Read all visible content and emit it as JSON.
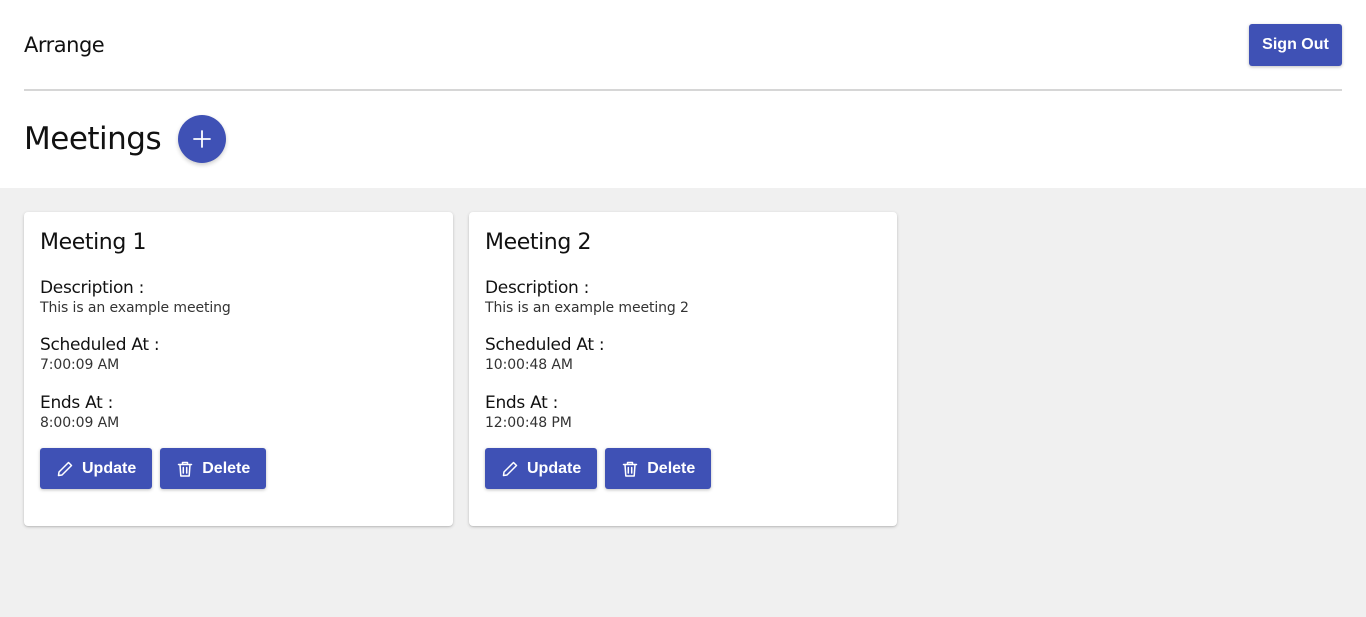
{
  "header": {
    "brand": "Arrange",
    "sign_out_label": "Sign Out"
  },
  "page": {
    "title": "Meetings",
    "add_icon": "plus-icon"
  },
  "meetings": [
    {
      "title": "Meeting 1",
      "description_label": "Description :",
      "description": "This is an example meeting",
      "scheduled_label": "Scheduled At :",
      "scheduled_at": "7:00:09 AM",
      "ends_label": "Ends At :",
      "ends_at": "8:00:09 AM",
      "update_label": "Update",
      "delete_label": "Delete"
    },
    {
      "title": "Meeting 2",
      "description_label": "Description :",
      "description": "This is an example meeting 2",
      "scheduled_label": "Scheduled At :",
      "scheduled_at": "10:00:48 AM",
      "ends_label": "Ends At :",
      "ends_at": "12:00:48 PM",
      "update_label": "Update",
      "delete_label": "Delete"
    }
  ],
  "colors": {
    "accent": "#3f51b5",
    "background": "#f0f0f0",
    "card": "#ffffff"
  },
  "icons": {
    "update": "pencil-icon",
    "delete": "trash-icon"
  }
}
